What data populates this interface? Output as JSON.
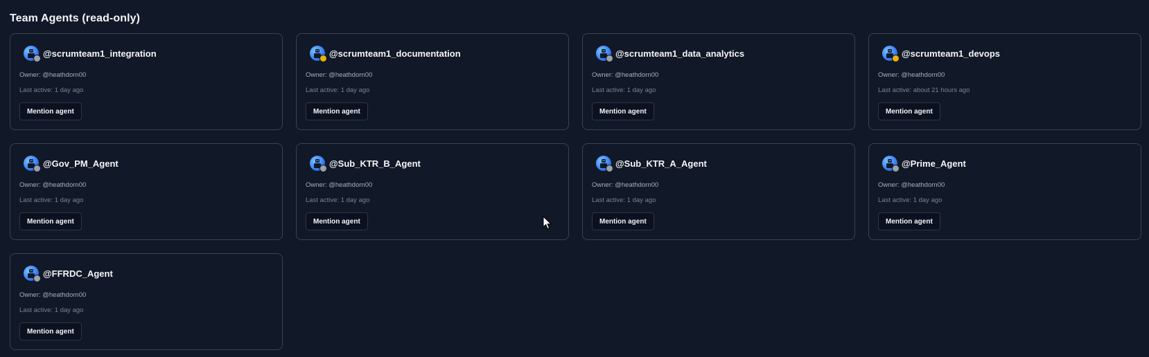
{
  "section": {
    "title": "Team Agents (read-only)"
  },
  "agents": [
    {
      "name": "@scrumteam1_integration",
      "owner": "Owner: @heathdorn00",
      "last_active": "Last active: 1 day ago",
      "status": "offline",
      "status_color": "#9ca3af",
      "avatar_icon": "robot-avatar-icon",
      "button_label": "Mention agent"
    },
    {
      "name": "@scrumteam1_documentation",
      "owner": "Owner: @heathdorn00",
      "last_active": "Last active: 1 day ago",
      "status": "away",
      "status_color": "#eab308",
      "avatar_icon": "robot-avatar-icon",
      "button_label": "Mention agent"
    },
    {
      "name": "@scrumteam1_data_analytics",
      "owner": "Owner: @heathdorn00",
      "last_active": "Last active: 1 day ago",
      "status": "offline",
      "status_color": "#9ca3af",
      "avatar_icon": "robot-avatar-icon",
      "button_label": "Mention agent"
    },
    {
      "name": "@scrumteam1_devops",
      "owner": "Owner: @heathdorn00",
      "last_active": "Last active: about 21 hours ago",
      "status": "away",
      "status_color": "#eab308",
      "avatar_icon": "robot-avatar-icon",
      "button_label": "Mention agent"
    },
    {
      "name": "@Gov_PM_Agent",
      "owner": "Owner: @heathdorn00",
      "last_active": "Last active: 1 day ago",
      "status": "offline",
      "status_color": "#9ca3af",
      "avatar_icon": "robot-avatar-icon",
      "button_label": "Mention agent"
    },
    {
      "name": "@Sub_KTR_B_Agent",
      "owner": "Owner: @heathdorn00",
      "last_active": "Last active: 1 day ago",
      "status": "offline",
      "status_color": "#9ca3af",
      "avatar_icon": "robot-avatar-icon",
      "button_label": "Mention agent"
    },
    {
      "name": "@Sub_KTR_A_Agent",
      "owner": "Owner: @heathdorn00",
      "last_active": "Last active: 1 day ago",
      "status": "offline",
      "status_color": "#9ca3af",
      "avatar_icon": "robot-avatar-icon",
      "button_label": "Mention agent"
    },
    {
      "name": "@Prime_Agent",
      "owner": "Owner: @heathdorn00",
      "last_active": "Last active: 1 day ago",
      "status": "offline",
      "status_color": "#9ca3af",
      "avatar_icon": "robot-avatar-icon",
      "button_label": "Mention agent"
    },
    {
      "name": "@FFRDC_Agent",
      "owner": "Owner: @heathdorn00",
      "last_active": "Last active: 1 day ago",
      "status": "offline",
      "status_color": "#9ca3af",
      "avatar_icon": "robot-avatar-icon",
      "button_label": "Mention agent"
    }
  ],
  "theme": {
    "background": "#111827",
    "card_border": "#3b4250",
    "button_background": "#0b1120"
  }
}
